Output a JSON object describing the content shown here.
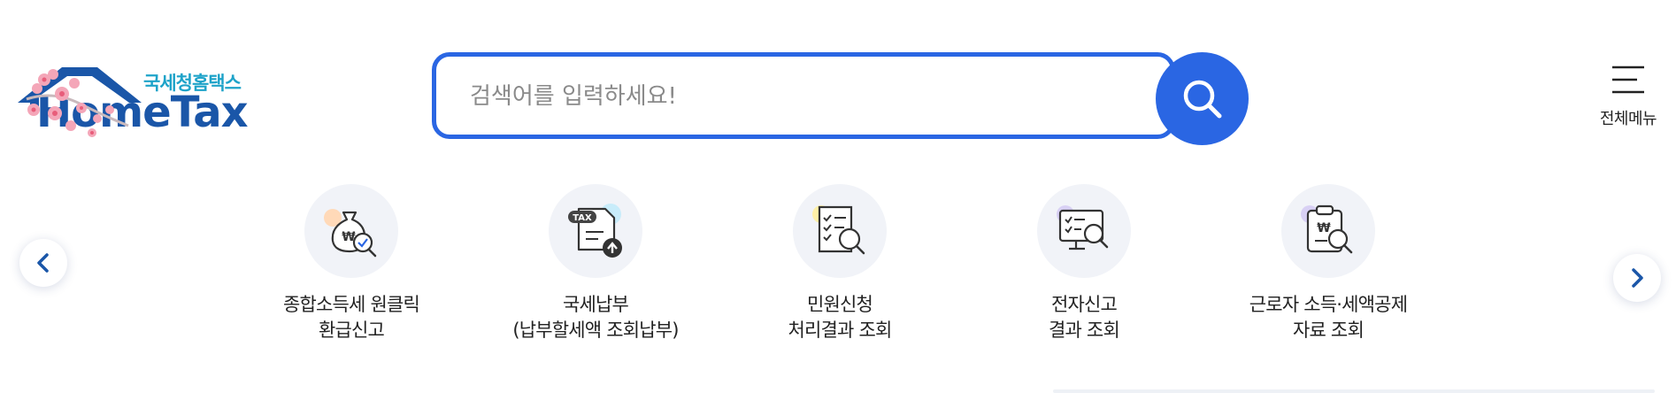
{
  "logo": {
    "subtitle": "국세청홈택스",
    "title": "HomeTax",
    "brand_color": "#1a56a8",
    "subtitle_color": "#1ea3c9"
  },
  "search": {
    "placeholder": "검색어를 입력하세요!",
    "value": "",
    "button_icon": "search-icon",
    "accent_color": "#2a66e3"
  },
  "menu": {
    "label": "전체메뉴",
    "icon": "hamburger-icon"
  },
  "carousel": {
    "prev_icon": "chevron-left-icon",
    "next_icon": "chevron-right-icon",
    "items": [
      {
        "label": "종합소득세 원클릭\n환급신고",
        "icon": "money-bag-search-icon"
      },
      {
        "label": "국세납부\n(납부할세액 조회납부)",
        "icon": "tax-document-upload-icon"
      },
      {
        "label": "민원신청\n처리결과 조회",
        "icon": "checklist-search-icon"
      },
      {
        "label": "전자신고\n결과 조회",
        "icon": "monitor-search-icon"
      },
      {
        "label": "근로자 소득·세액공제\n자료 조회",
        "icon": "clipboard-won-search-icon"
      }
    ]
  }
}
